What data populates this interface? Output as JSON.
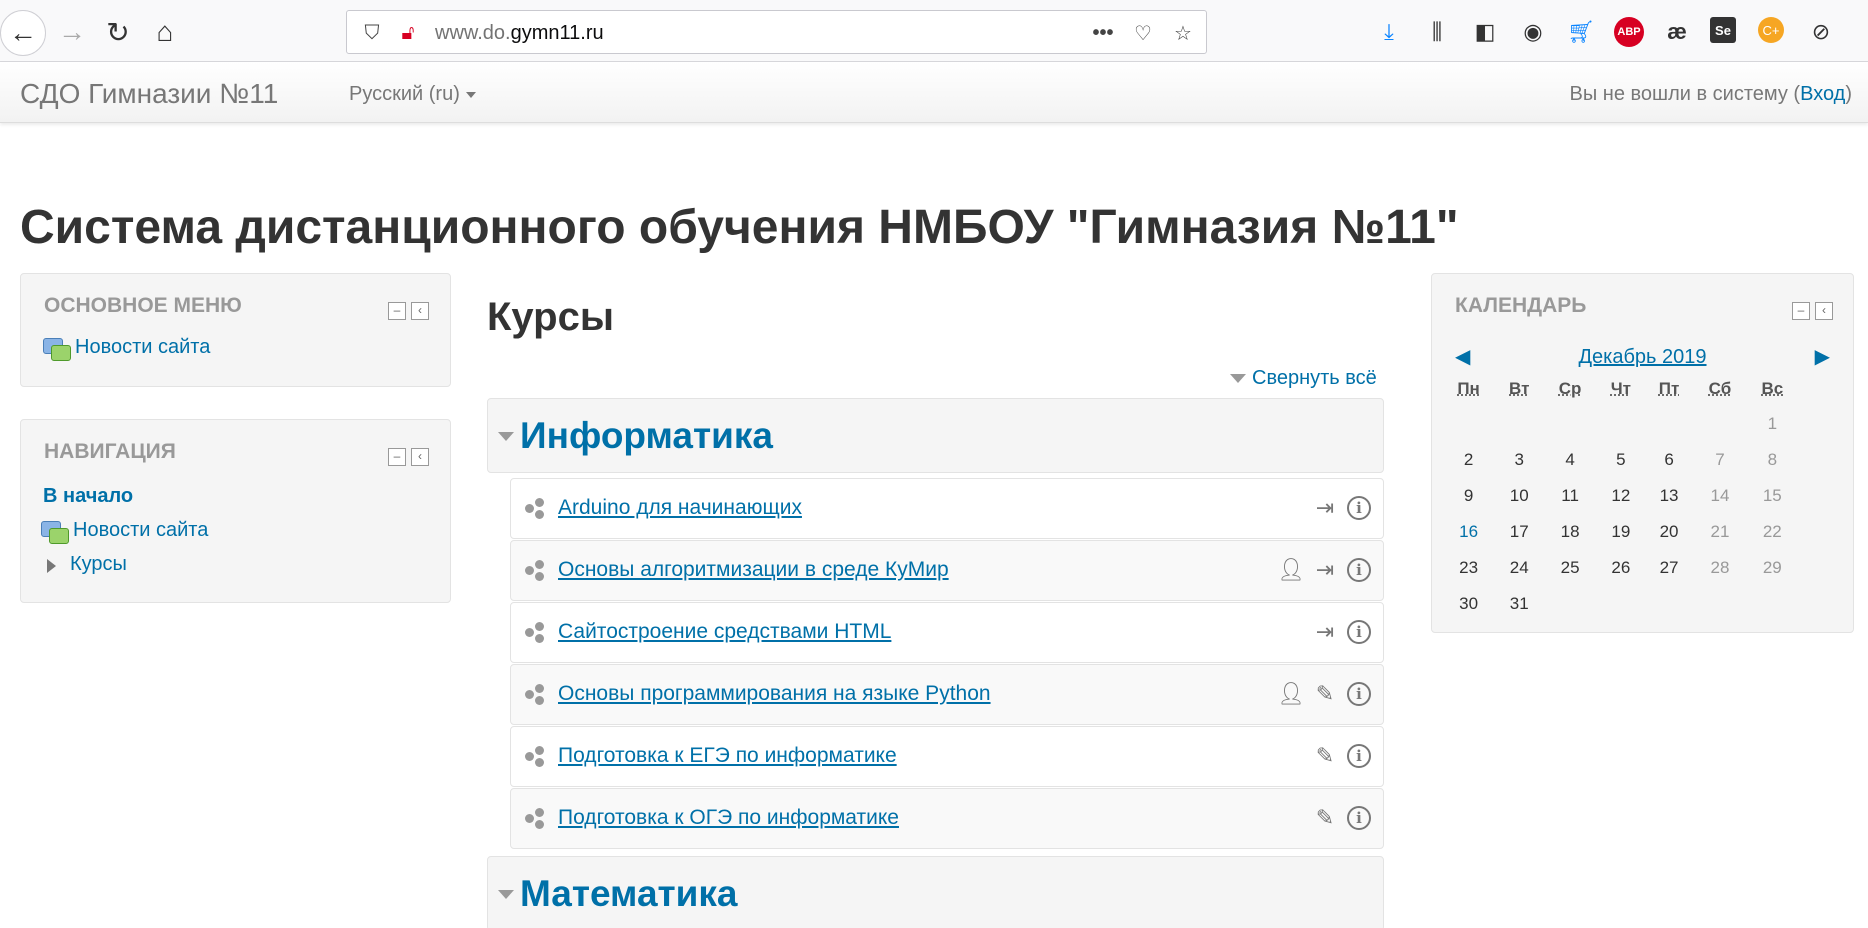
{
  "browser": {
    "url_prefix": "www.do.",
    "url_domain": "gymn11.ru"
  },
  "navbar": {
    "brand": "СДО Гимназии №11",
    "language": "Русский (ru)",
    "login_text": "Вы не вошли в систему (",
    "login_link": "Вход",
    "login_close": ")"
  },
  "page_title": "Система дистанционного обучения НМБОУ \"Гимназия №11\"",
  "main_menu": {
    "title": "Основное меню",
    "items": [
      {
        "label": "Новости сайта"
      }
    ]
  },
  "navigation": {
    "title": "Навигация",
    "home": "В начало",
    "news": "Новости сайта",
    "courses": "Курсы"
  },
  "courses": {
    "heading": "Курсы",
    "collapse_all": "Свернуть всё",
    "categories": [
      {
        "name": "Информатика",
        "items": [
          {
            "name": "Arduino для начинающих",
            "icons": [
              "enrol"
            ]
          },
          {
            "name": "Основы алгоритмизации в среде КуМир",
            "icons": [
              "user",
              "enrol"
            ]
          },
          {
            "name": "Сайтостроение средствами HTML",
            "icons": [
              "enrol"
            ]
          },
          {
            "name": "Основы программирования на языке Python",
            "icons": [
              "user",
              "key"
            ]
          },
          {
            "name": "Подготовка к ЕГЭ по информатике",
            "icons": [
              "key"
            ]
          },
          {
            "name": "Подготовка к ОГЭ по информатике",
            "icons": [
              "key"
            ]
          }
        ]
      },
      {
        "name": "Математика",
        "items": []
      }
    ]
  },
  "calendar": {
    "title": "Календарь",
    "month": "Декабрь 2019",
    "weekdays": [
      "Пн",
      "Вт",
      "Ср",
      "Чт",
      "Пт",
      "Сб",
      "Вс"
    ],
    "weeks": [
      [
        "",
        "",
        "",
        "",
        "",
        "",
        "1"
      ],
      [
        "2",
        "3",
        "4",
        "5",
        "6",
        "7",
        "8"
      ],
      [
        "9",
        "10",
        "11",
        "12",
        "13",
        "14",
        "15"
      ],
      [
        "16",
        "17",
        "18",
        "19",
        "20",
        "21",
        "22"
      ],
      [
        "23",
        "24",
        "25",
        "26",
        "27",
        "28",
        "29"
      ],
      [
        "30",
        "31",
        "",
        "",
        "",
        "",
        ""
      ]
    ],
    "today": "16"
  }
}
